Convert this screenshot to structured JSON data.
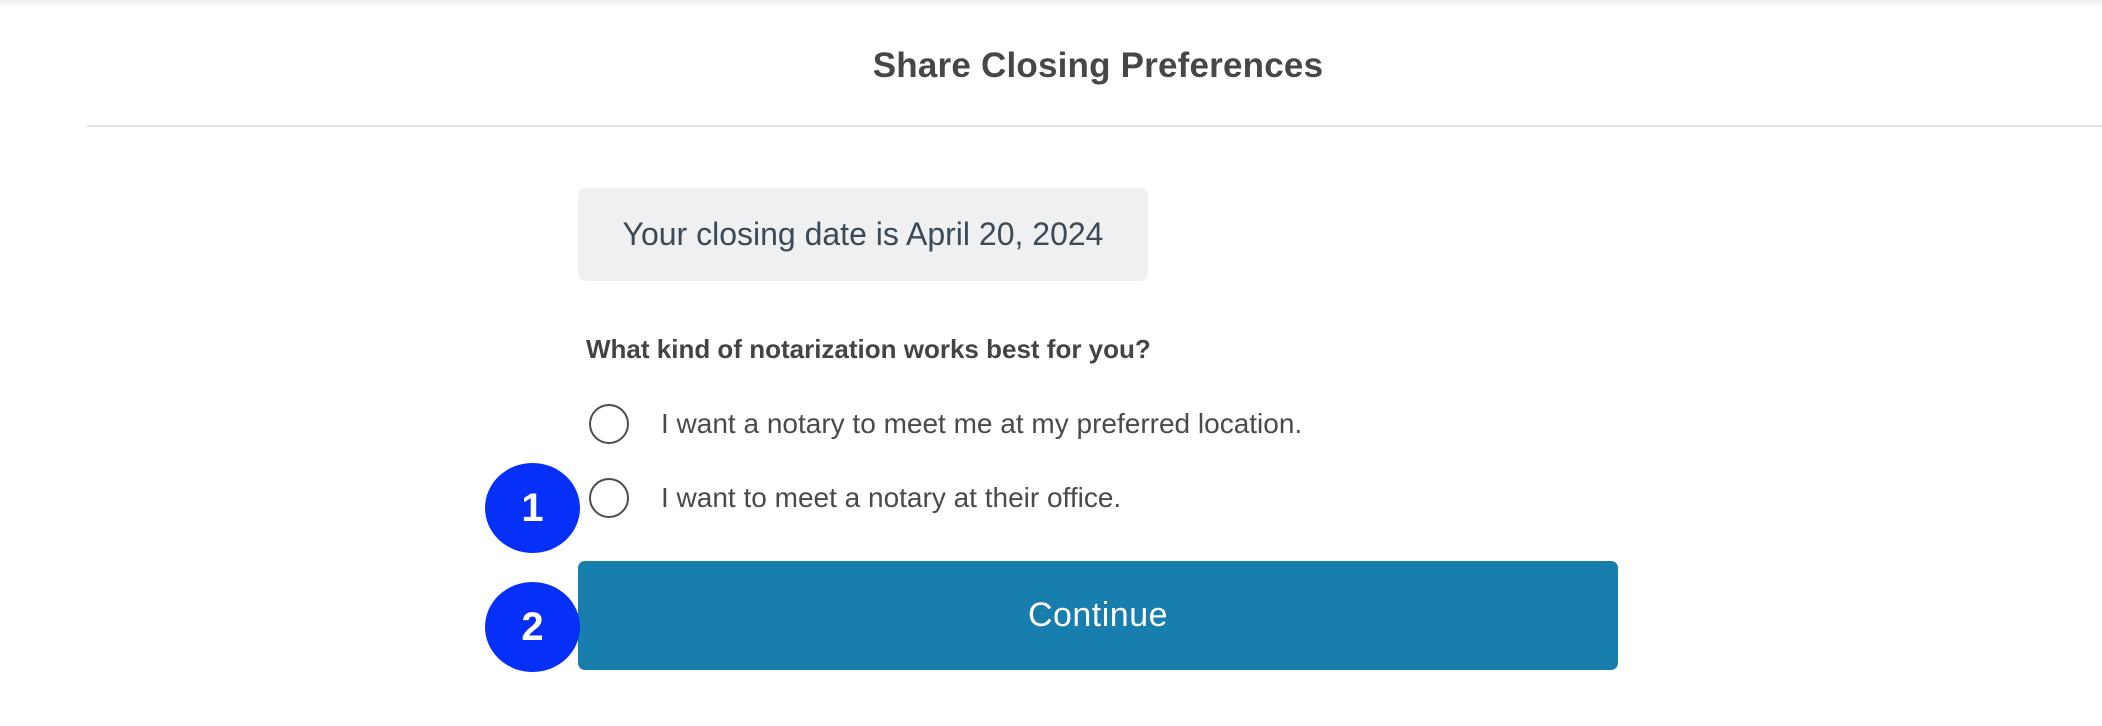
{
  "header": {
    "title": "Share Closing Preferences"
  },
  "closing_info": {
    "date_text": "Your closing date is April 20, 2024"
  },
  "notarization": {
    "question": "What kind of notarization works best for you?",
    "options": [
      {
        "label": "I want a notary to meet me at my preferred location.",
        "selected": false
      },
      {
        "label": "I want to meet a notary at their office.",
        "selected": false
      }
    ]
  },
  "actions": {
    "continue_label": "Continue"
  },
  "markers": [
    "1",
    "2"
  ],
  "colors": {
    "button": "#177eae",
    "marker": "#0630f7",
    "date_box_bg": "#eef0f1"
  }
}
